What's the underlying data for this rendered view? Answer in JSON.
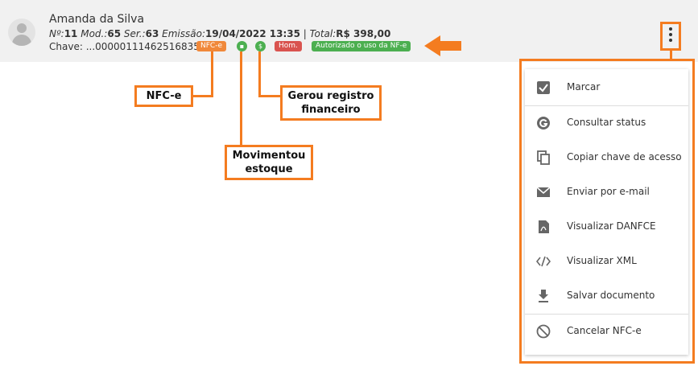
{
  "entry": {
    "name": "Amanda da Silva",
    "numero_label": "Nº:",
    "numero": "11",
    "modelo_label": "Mod.:",
    "modelo": "65",
    "serie_label": "Ser.:",
    "serie": "63",
    "emissao_label": "Emissão:",
    "emissao": "19/04/2022 13:35",
    "total_label": "Total:",
    "total": "R$ 398,00",
    "chave_label": "Chave:",
    "chave": "...00000111462516835",
    "badges": {
      "tipo": "NFC-e",
      "ambiente": "Hom.",
      "status": "Autorizado o uso da NF-e"
    }
  },
  "annotations": {
    "nfce": "NFC-e",
    "movimentou_line1": "Movimentou",
    "movimentou_line2": "estoque",
    "gerou_line1": "Gerou registro",
    "gerou_line2": "financeiro"
  },
  "menu": {
    "items": [
      {
        "label": "Marcar",
        "icon": "checkbox-checked-icon"
      },
      {
        "label": "Consultar status",
        "icon": "refresh-g-icon"
      },
      {
        "label": "Copiar chave de acesso",
        "icon": "copy-icon"
      },
      {
        "label": "Enviar por e-mail",
        "icon": "mail-icon"
      },
      {
        "label": "Visualizar DANFCE",
        "icon": "pdf-icon"
      },
      {
        "label": "Visualizar XML",
        "icon": "code-icon"
      },
      {
        "label": "Salvar documento",
        "icon": "download-icon"
      },
      {
        "label": "Cancelar NFC-e",
        "icon": "block-icon"
      }
    ]
  },
  "colors": {
    "annotation_orange": "#f47c20",
    "badge_nfce": "#f0883a",
    "badge_hom": "#d9534f",
    "badge_status": "#4caf50"
  }
}
